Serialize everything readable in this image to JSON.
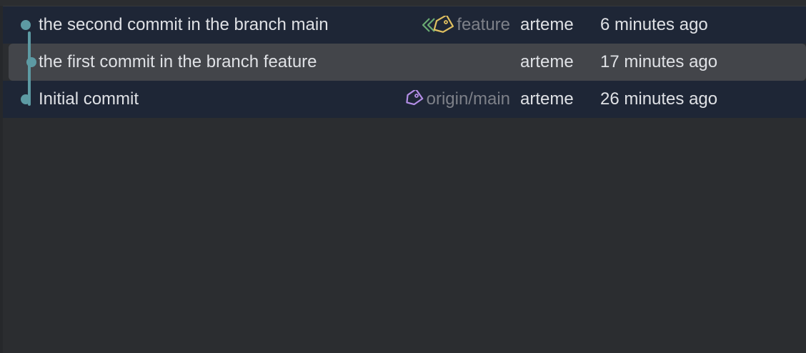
{
  "log": {
    "commits": [
      {
        "message": "the second commit in the branch main",
        "ref": "feature",
        "ref_icon": "branch-tags-icon",
        "author": "arteme",
        "date": "6 minutes ago"
      },
      {
        "message": "the first commit in the branch feature",
        "ref": "",
        "author": "arteme",
        "date": "17 minutes ago"
      },
      {
        "message": "Initial commit",
        "ref": "origin/main",
        "ref_icon": "tag-icon",
        "author": "arteme",
        "date": "26 minutes ago"
      }
    ]
  },
  "colors": {
    "row_bg": "#1e2636",
    "selected_bg": "#43454a",
    "graph": "#5d9aa3",
    "tag_green": "#6aab73",
    "tag_yellow": "#e0c060",
    "tag_purple": "#b38ee6",
    "ref_text": "#7d8088"
  }
}
